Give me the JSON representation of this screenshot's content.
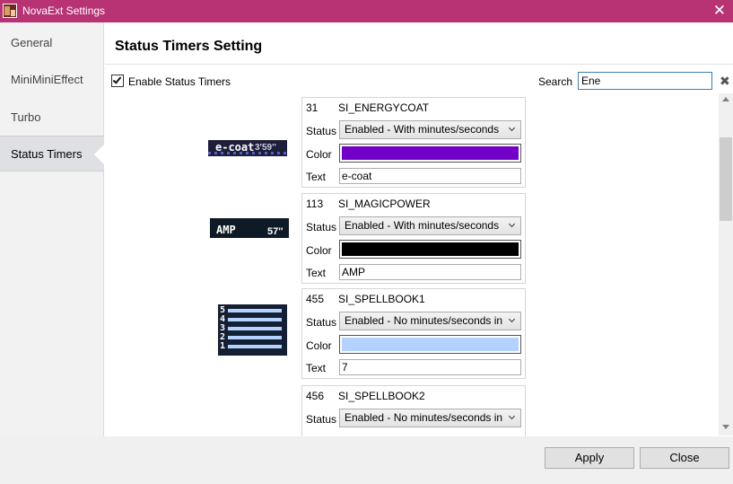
{
  "window": {
    "title": "NovaExt Settings"
  },
  "sidebar": {
    "items": [
      {
        "label": "General"
      },
      {
        "label": "MiniMiniEffect"
      },
      {
        "label": "Turbo"
      },
      {
        "label": "Status Timers",
        "active": true
      }
    ]
  },
  "main": {
    "title": "Status Timers Setting",
    "enable_label": "Enable Status Timers",
    "enable_checked": true,
    "search_label": "Search",
    "search_value": "Ene"
  },
  "timers": [
    {
      "id": "31",
      "name": "SI_ENERGYCOAT",
      "status_label": "Status",
      "status": "Enabled - With minutes/seconds",
      "color_label": "Color",
      "color": "#7200c8",
      "text_label": "Text",
      "text": "e-coat"
    },
    {
      "id": "113",
      "name": "SI_MAGICPOWER",
      "status_label": "Status",
      "status": "Enabled - With minutes/seconds",
      "color_label": "Color",
      "color": "#000000",
      "text_label": "Text",
      "text": "AMP"
    },
    {
      "id": "455",
      "name": "SI_SPELLBOOK1",
      "status_label": "Status",
      "status": "Enabled - No minutes/seconds in",
      "color_label": "Color",
      "color": "#b4d2ff",
      "text_label": "Text",
      "text": "7"
    },
    {
      "id": "456",
      "name": "SI_SPELLBOOK2",
      "status_label": "Status",
      "status": "Enabled - No minutes/seconds in"
    }
  ],
  "previews": {
    "energycoat": {
      "text": "e-coat",
      "time": "3'59''"
    },
    "magicpower": {
      "text": "AMP",
      "time": "57''"
    },
    "spellbook": {
      "numbers": [
        "5",
        "4",
        "3",
        "2",
        "1"
      ]
    }
  },
  "footer": {
    "apply_label": "Apply",
    "close_label": "Close"
  }
}
